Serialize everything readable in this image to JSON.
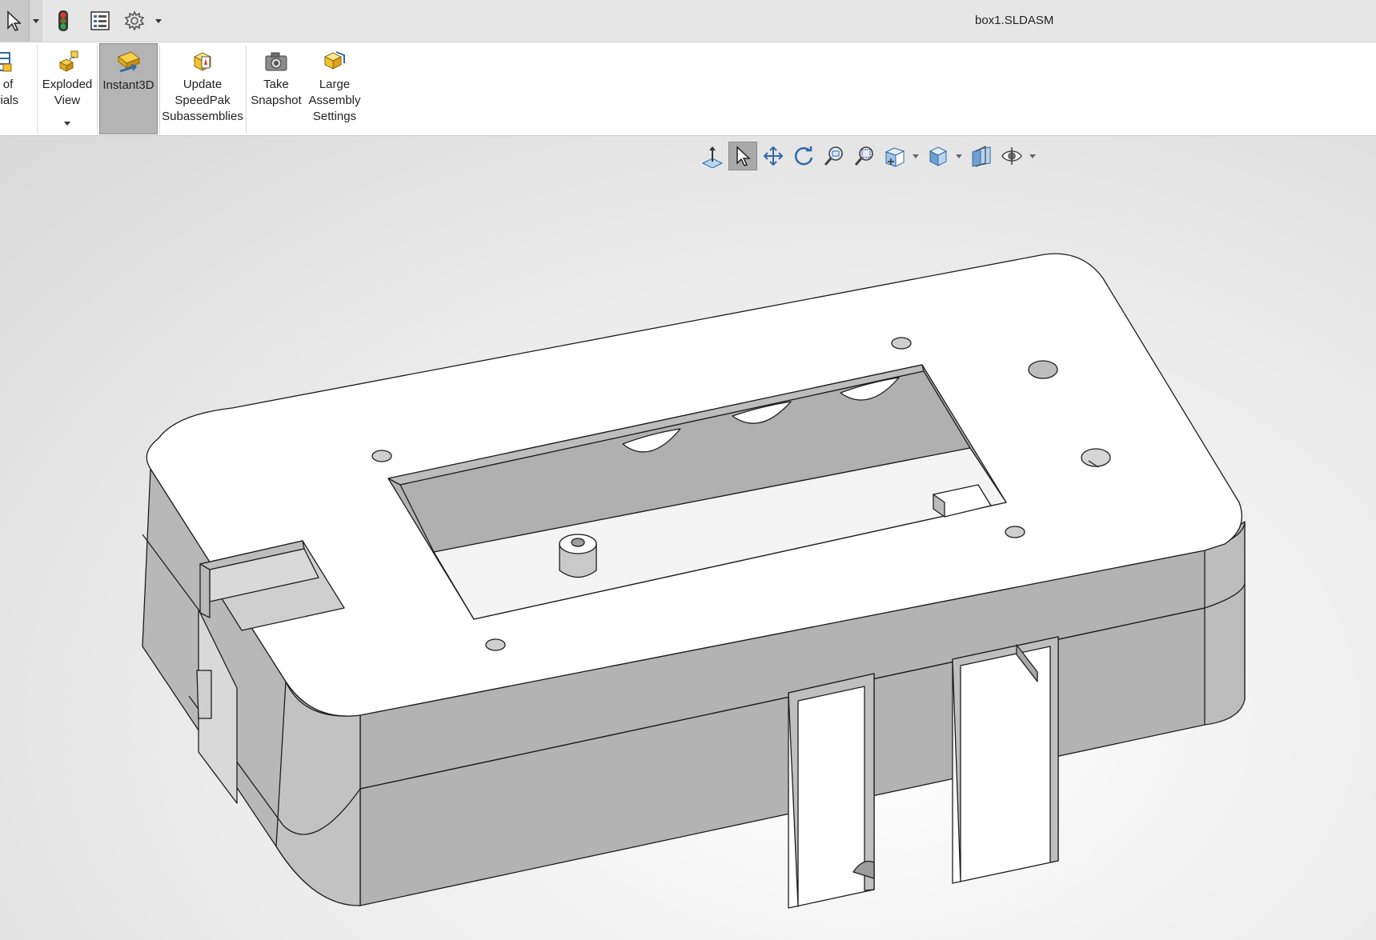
{
  "window": {
    "title": "box1.SLDASM"
  },
  "quick_access": {
    "select_icon": "select-arrow-icon",
    "rebuild_icon": "traffic-light-icon",
    "file_properties_icon": "list-icon",
    "options_icon": "gear-icon"
  },
  "ribbon": {
    "bill_of_materials_label": "ill of\nterials",
    "exploded_view_label": "Exploded\nView",
    "instant3d_label": "Instant3D",
    "update_speedpak_label": "Update\nSpeedPak\nSubassemblies",
    "take_snapshot_label": "Take\nSnapshot",
    "large_assembly_label": "Large\nAssembly\nSettings",
    "active_tool": "Instant3D"
  },
  "heads_up_toolbar": {
    "items": [
      "view-normal-icon",
      "select-icon",
      "pan-icon",
      "rotate-icon",
      "zoom-to-fit-icon",
      "zoom-to-area-icon",
      "view-orientation-icon",
      "display-style-icon",
      "section-view-icon",
      "hide-show-icon"
    ],
    "active": "select-icon"
  },
  "colors": {
    "model_top": "#ffffff",
    "model_side": "#b3b3b3",
    "model_edge": "#1e1e1e",
    "ribbon_active": "#b4b4b4"
  }
}
